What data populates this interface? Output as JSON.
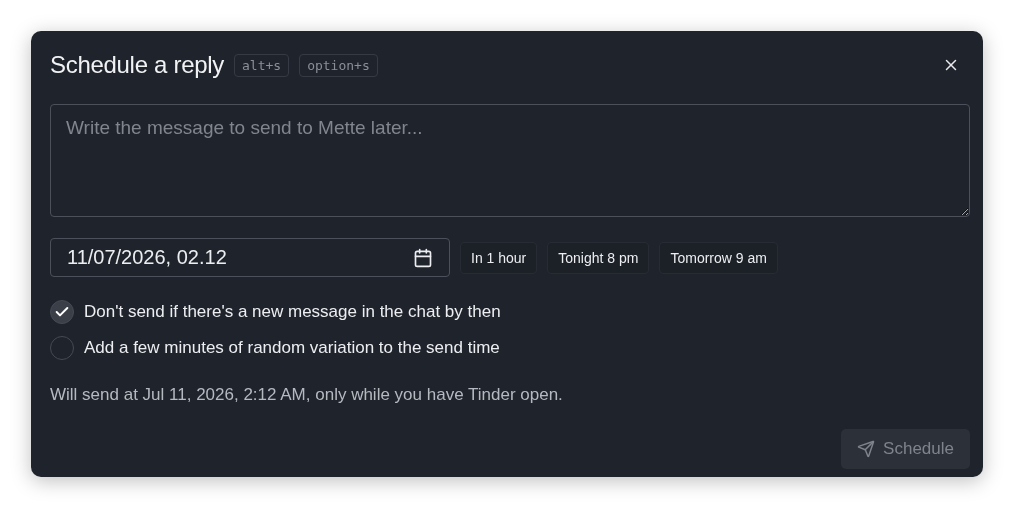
{
  "dialog": {
    "title": "Schedule a reply",
    "shortcuts": [
      "alt+s",
      "option+s"
    ]
  },
  "message": {
    "placeholder": "Write the message to send to Mette later..."
  },
  "datetime": {
    "value": "11/07/2026, 02.12"
  },
  "presets": [
    "In 1 hour",
    "Tonight 8 pm",
    "Tomorrow 9 am"
  ],
  "options": [
    {
      "label": "Don't send if there's a new message in the chat by then",
      "checked": true
    },
    {
      "label": "Add a few minutes of random variation to the send time",
      "checked": false
    }
  ],
  "info": "Will send at Jul 11, 2026, 2:12 AM, only while you have Tinder open.",
  "submit": {
    "label": "Schedule",
    "disabled": true
  }
}
